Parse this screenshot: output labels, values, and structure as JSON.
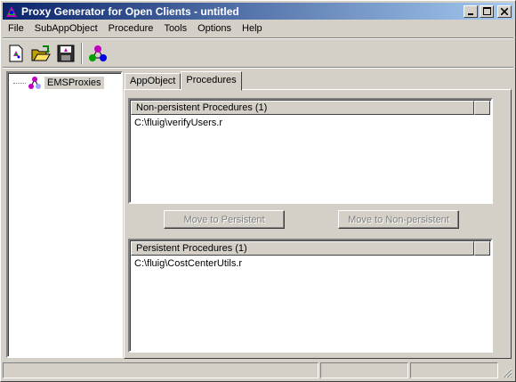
{
  "window": {
    "title": "Proxy Generator for Open Clients - untitled"
  },
  "title_buttons": {
    "minimize": "_",
    "maximize": "□",
    "close": "×"
  },
  "menu": [
    "File",
    "SubAppObject",
    "Procedure",
    "Tools",
    "Options",
    "Help"
  ],
  "toolbar": {
    "items": [
      "new-project-icon",
      "open-folder-icon",
      "save-disk-icon",
      "appobject-icon"
    ]
  },
  "tree": {
    "root_label": "EMSProxies"
  },
  "tabs": [
    {
      "label": "AppObject",
      "active": false
    },
    {
      "label": "Procedures",
      "active": true
    }
  ],
  "non_persistent": {
    "header": "Non-persistent Procedures (1)",
    "rows": [
      "C:\\fluig\\verifyUsers.r"
    ]
  },
  "persistent": {
    "header": "Persistent Procedures (1)",
    "rows": [
      "C:\\fluig\\CostCenterUtils.r"
    ]
  },
  "buttons": {
    "move_to_persistent": "Move to Persistent",
    "move_to_non_persistent": "Move to Non-persistent"
  },
  "colors": {
    "titlebar_start": "#0a246a",
    "titlebar_end": "#a6caf0",
    "face": "#d4d0c8"
  }
}
